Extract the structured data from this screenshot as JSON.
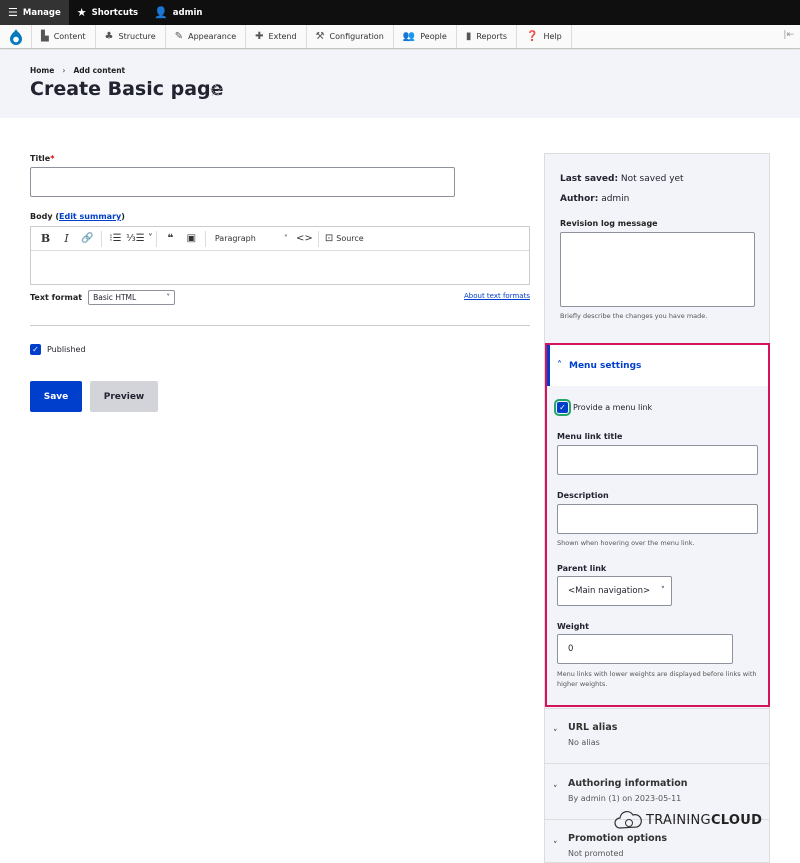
{
  "toolbar": {
    "manage": "Manage",
    "shortcuts": "Shortcuts",
    "user": "admin"
  },
  "admin_menu": {
    "items": [
      "Content",
      "Structure",
      "Appearance",
      "Extend",
      "Configuration",
      "People",
      "Reports",
      "Help"
    ]
  },
  "header": {
    "breadcrumb": [
      "Home",
      "Add content"
    ],
    "breadcrumb_sep": "›",
    "title": "Create Basic page"
  },
  "form": {
    "title_label": "Title",
    "title_required": "*",
    "title_value": "",
    "body_label": "Body",
    "edit_summary": "Edit summary",
    "editor": {
      "paragraph": "Paragraph",
      "source": "Source"
    },
    "text_format_label": "Text format",
    "text_format_value": "Basic HTML",
    "about_text_formats": "About text formats",
    "published_label": "Published",
    "published_checked": true,
    "save": "Save",
    "preview": "Preview"
  },
  "sidebar": {
    "last_saved_label": "Last saved:",
    "last_saved_value": "Not saved yet",
    "author_label": "Author:",
    "author_value": "admin",
    "revision_label": "Revision log message",
    "revision_desc": "Briefly describe the changes you have made.",
    "menu_settings": {
      "heading": "Menu settings",
      "provide_label": "Provide a menu link",
      "provide_checked": true,
      "link_title_label": "Menu link title",
      "description_label": "Description",
      "description_help": "Shown when hovering over the menu link.",
      "parent_label": "Parent link",
      "parent_value": "<Main navigation>",
      "weight_label": "Weight",
      "weight_value": "0",
      "weight_help": "Menu links with lower weights are displayed before links with higher weights."
    },
    "sections": [
      {
        "title": "URL alias",
        "summary": "No alias"
      },
      {
        "title": "Authoring information",
        "summary": "By admin (1) on 2023-05-11"
      },
      {
        "title": "Promotion options",
        "summary": "Not promoted"
      }
    ]
  },
  "watermark": {
    "part1": "TRAINING",
    "part2": "CLOUD"
  },
  "colors": {
    "accent": "#003ecc",
    "highlight_border": "#d3135b",
    "toolbar_bg": "#0f0f0f",
    "header_bg": "#f3f4f9"
  }
}
